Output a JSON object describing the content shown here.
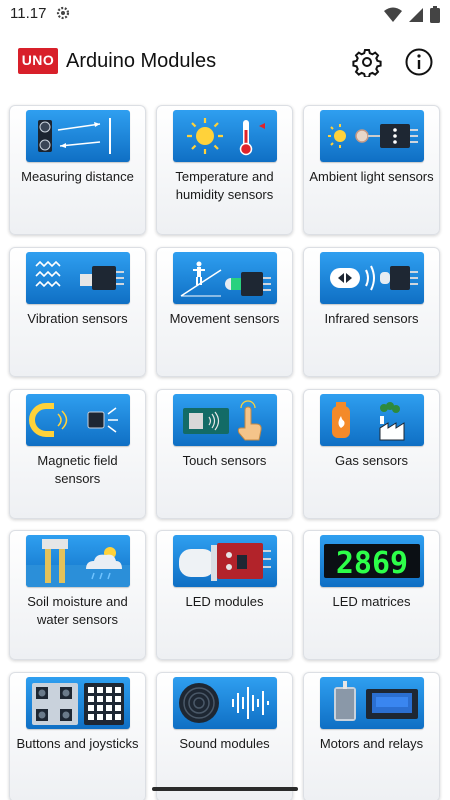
{
  "status_bar": {
    "time": "11.17"
  },
  "app_bar": {
    "logo_text": "UNO",
    "title": "Arduino Modules"
  },
  "modules": [
    {
      "label": "Measuring distance"
    },
    {
      "label": "Temperature and humidity sensors"
    },
    {
      "label": "Ambient light sensors"
    },
    {
      "label": "Vibration sensors"
    },
    {
      "label": "Movement sensors"
    },
    {
      "label": "Infrared sensors"
    },
    {
      "label": "Magnetic field sensors"
    },
    {
      "label": "Touch sensors"
    },
    {
      "label": "Gas sensors"
    },
    {
      "label": "Soil moisture and water sensors"
    },
    {
      "label": "LED modules"
    },
    {
      "label": "LED matrices",
      "display_digits": "2869"
    },
    {
      "label": "Buttons and joysticks"
    },
    {
      "label": "Sound modules"
    },
    {
      "label": "Motors and relays"
    }
  ],
  "colors": {
    "accent": "#1a86dc",
    "brand_red": "#d8202a",
    "card_bg": "#f3f4f6"
  }
}
